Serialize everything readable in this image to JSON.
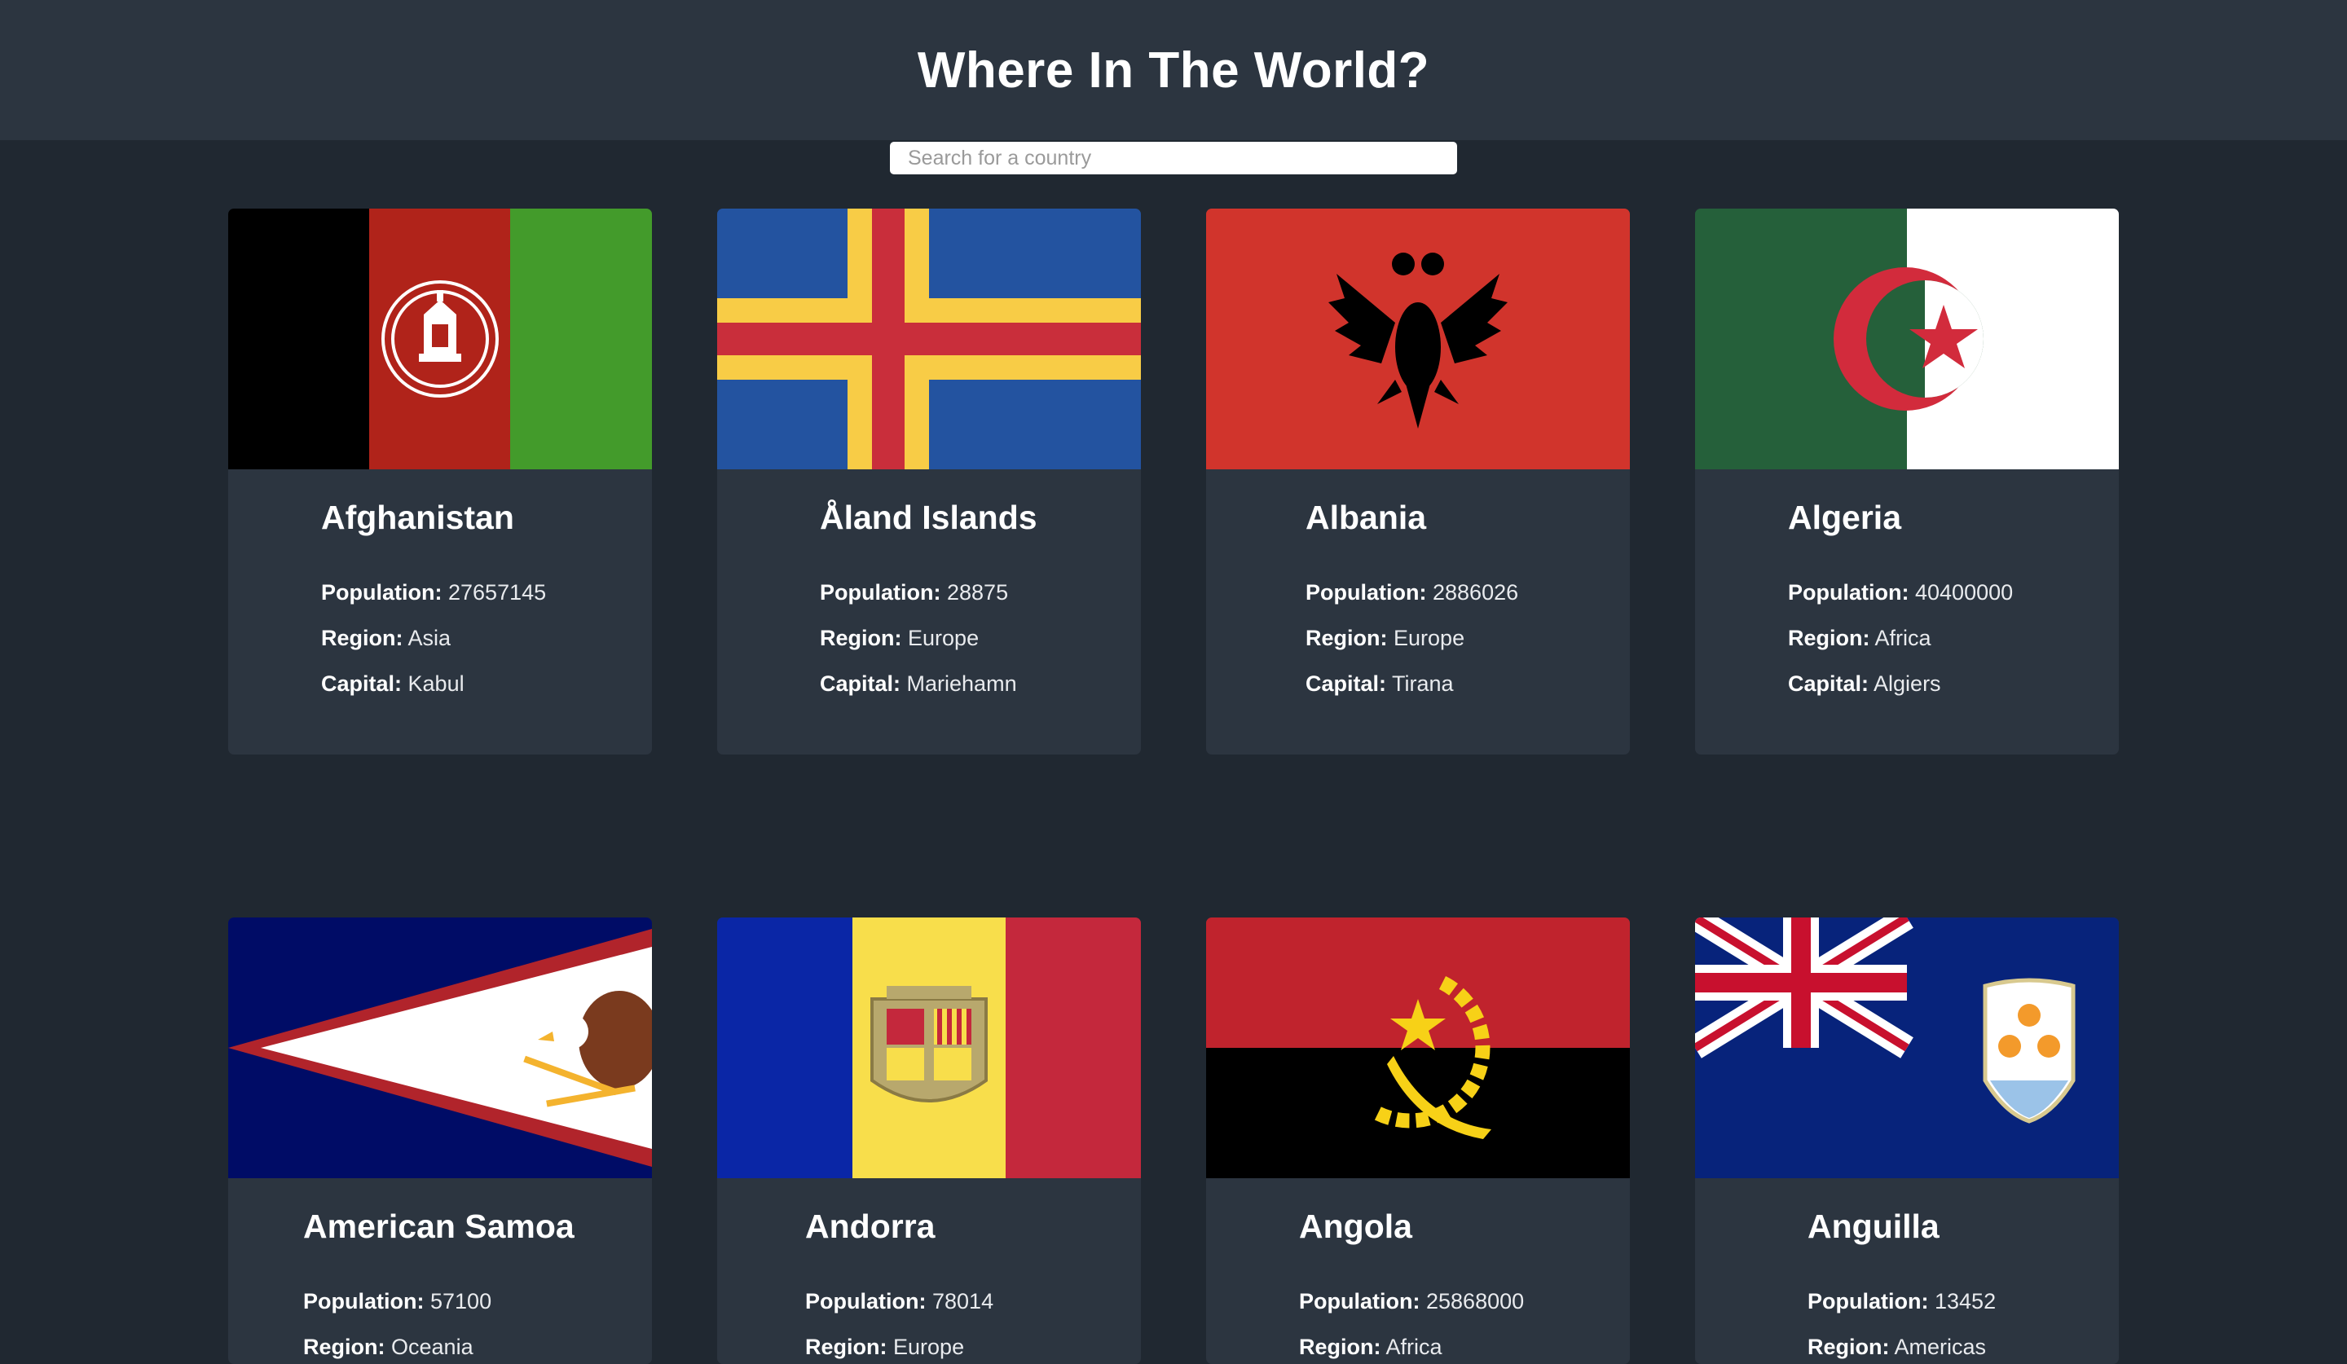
{
  "header": {
    "title": "Where In The World?"
  },
  "search": {
    "placeholder": "Search for a country",
    "value": ""
  },
  "labels": {
    "population": "Population:",
    "region": "Region:",
    "capital": "Capital:"
  },
  "countries": [
    {
      "name": "Afghanistan",
      "population": "27657145",
      "region": "Asia",
      "capital": "Kabul",
      "flag_icon": "afghanistan-flag-icon"
    },
    {
      "name": "Åland Islands",
      "population": "28875",
      "region": "Europe",
      "capital": "Mariehamn",
      "flag_icon": "aland-islands-flag-icon"
    },
    {
      "name": "Albania",
      "population": "2886026",
      "region": "Europe",
      "capital": "Tirana",
      "flag_icon": "albania-flag-icon"
    },
    {
      "name": "Algeria",
      "population": "40400000",
      "region": "Africa",
      "capital": "Algiers",
      "flag_icon": "algeria-flag-icon"
    },
    {
      "name": "American Samoa",
      "population": "57100",
      "region": "Oceania",
      "capital": "",
      "flag_icon": "american-samoa-flag-icon"
    },
    {
      "name": "Andorra",
      "population": "78014",
      "region": "Europe",
      "capital": "",
      "flag_icon": "andorra-flag-icon"
    },
    {
      "name": "Angola",
      "population": "25868000",
      "region": "Africa",
      "capital": "",
      "flag_icon": "angola-flag-icon"
    },
    {
      "name": "Anguilla",
      "population": "13452",
      "region": "Americas",
      "capital": "",
      "flag_icon": "anguilla-flag-icon"
    }
  ],
  "colors": {
    "background": "#202831",
    "header": "#2c3540",
    "card": "#2c3540"
  }
}
